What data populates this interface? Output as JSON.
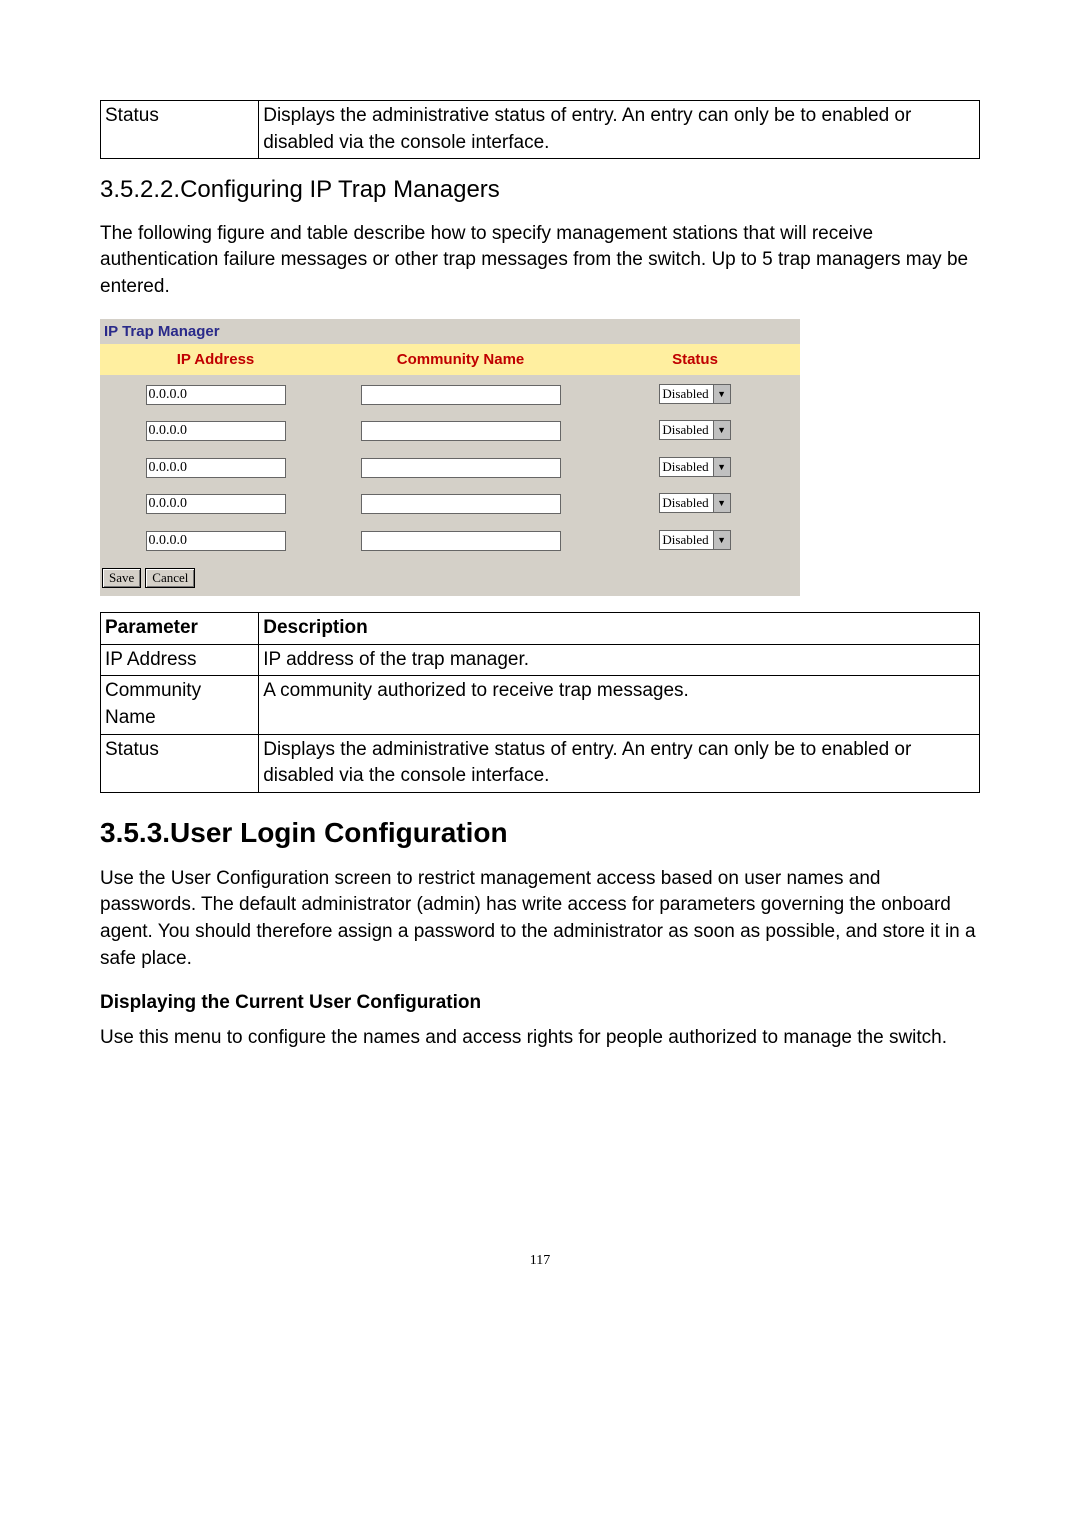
{
  "top_table": {
    "col1": "Status",
    "col2": "Displays the administrative status of entry. An entry can only be to enabled or disabled via the console interface."
  },
  "sec1": {
    "heading": "3.5.2.2.Configuring IP Trap Managers",
    "para": "The following figure and table describe how to specify management stations that will receive authentication failure messages or other trap messages from the switch. Up to 5 trap managers may be entered."
  },
  "trap": {
    "title": "IP Trap Manager",
    "headers": {
      "ip": "IP Address",
      "comm": "Community Name",
      "status": "Status"
    },
    "rows": [
      {
        "ip": "0.0.0.0",
        "comm": "",
        "status": "Disabled"
      },
      {
        "ip": "0.0.0.0",
        "comm": "",
        "status": "Disabled"
      },
      {
        "ip": "0.0.0.0",
        "comm": "",
        "status": "Disabled"
      },
      {
        "ip": "0.0.0.0",
        "comm": "",
        "status": "Disabled"
      },
      {
        "ip": "0.0.0.0",
        "comm": "",
        "status": "Disabled"
      }
    ],
    "save": "Save",
    "cancel": "Cancel"
  },
  "param_table": {
    "h1": "Parameter",
    "h2": "Description",
    "rows": [
      {
        "p": "IP Address",
        "d": "IP address of the trap manager."
      },
      {
        "p": "Community Name",
        "d": "A community authorized to receive trap messages."
      },
      {
        "p": "Status",
        "d": "Displays the administrative status of entry. An entry can only be to enabled or disabled via the console interface."
      }
    ]
  },
  "sec2": {
    "heading": "3.5.3.User Login Configuration",
    "para1": "Use the User Configuration screen to restrict management access based on user names and passwords. The default administrator (admin) has write access for parameters governing the onboard agent. You should therefore assign a password to the administrator as soon as possible, and store it in a safe place.",
    "sub": "Displaying the Current User Configuration",
    "para2": "Use this menu to configure the names and access rights for people authorized to manage the switch."
  },
  "page_num": "117"
}
